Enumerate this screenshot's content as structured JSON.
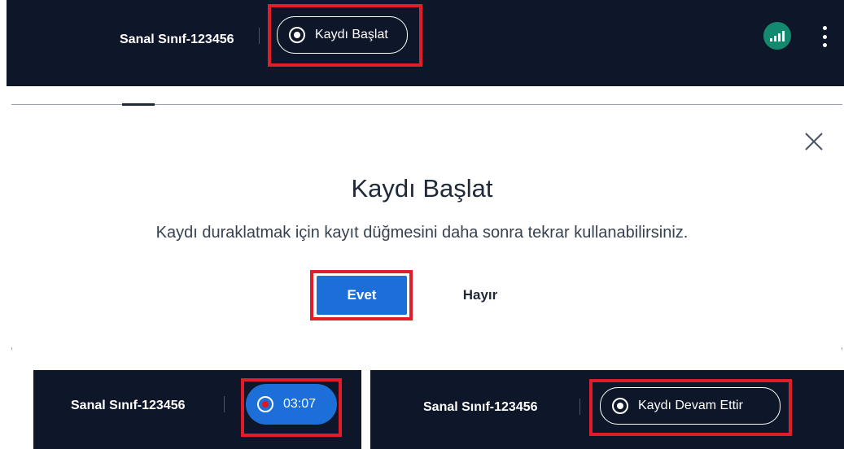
{
  "top_bar": {
    "class_name": "Sanal Sınıf-123456",
    "record_button_label": "Kaydı Başlat"
  },
  "dialog": {
    "title": "Kaydı Başlat",
    "message": "Kaydı duraklatmak için kayıt düğmesini daha sonra tekrar kullanabilirsiniz.",
    "yes_label": "Evet",
    "no_label": "Hayır"
  },
  "recording_bar": {
    "class_name": "Sanal Sınıf-123456",
    "timer": "03:07"
  },
  "paused_bar": {
    "class_name": "Sanal Sınıf-123456",
    "resume_button_label": "Kaydı Devam Ettir"
  },
  "colors": {
    "bar_background": "#0e1729",
    "highlight_red": "#e11d2a",
    "primary_blue": "#1c6fd8",
    "signal_green": "#138a6f",
    "record_dot_red": "#e0181a"
  },
  "icons": [
    "record-icon",
    "signal-strength-icon",
    "more-options-icon",
    "close-icon"
  ]
}
